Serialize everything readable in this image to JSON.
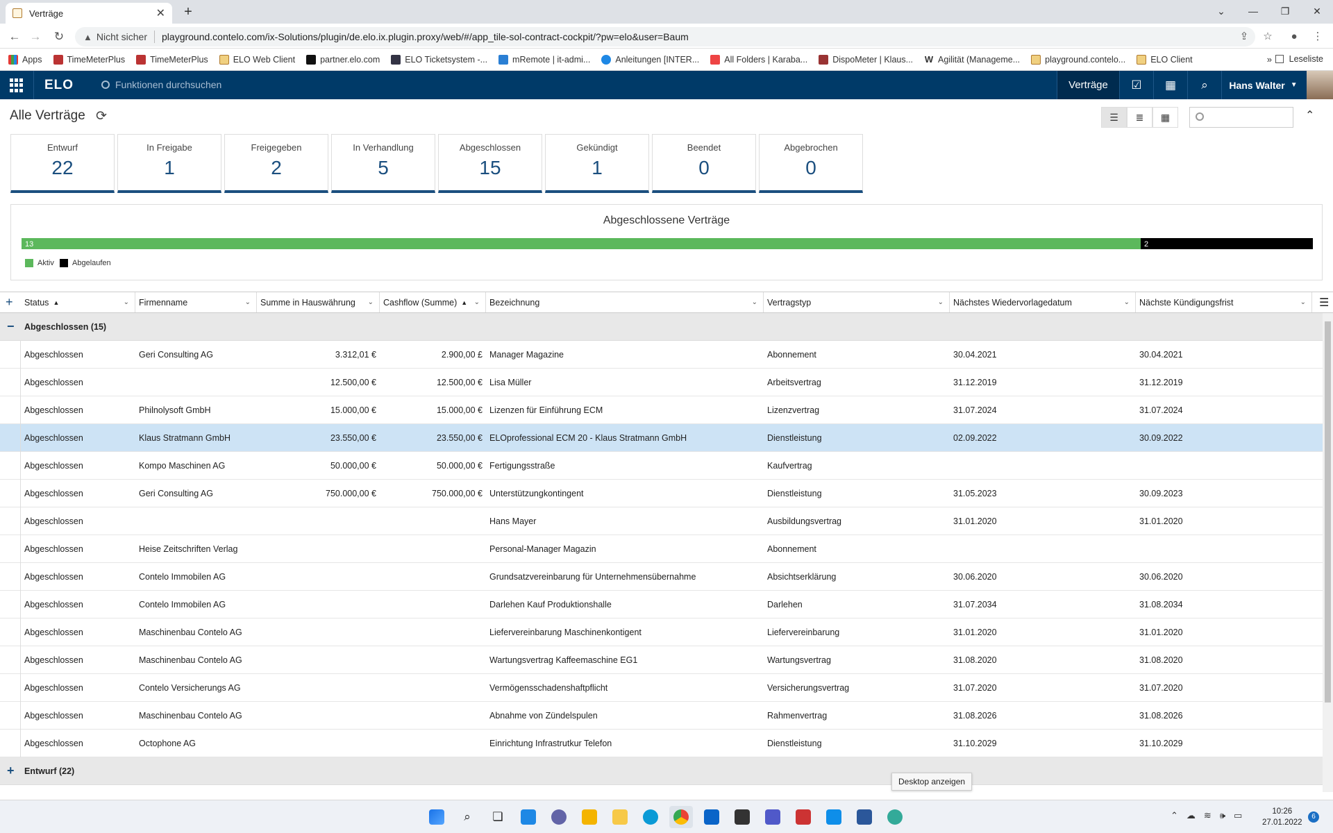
{
  "browser": {
    "tab_title": "Verträge",
    "security_label": "Nicht sicher",
    "url": "playground.contelo.com/ix-Solutions/plugin/de.elo.ix.plugin.proxy/web/#/app_tile-sol-contract-cockpit/?pw=elo&user=Baum",
    "bookmarks": [
      "Apps",
      "TimeMeterPlus",
      "TimeMeterPlus",
      "ELO Web Client",
      "partner.elo.com",
      "ELO Ticketsystem -...",
      "mRemote | it-admi...",
      "Anleitungen [INTER...",
      "All Folders | Karaba...",
      "DispoMeter | Klaus...",
      "Agilität (Manageme...",
      "playground.contelo...",
      "ELO Client"
    ],
    "bookmarks_more": "»",
    "reading_list": "Leseliste"
  },
  "app": {
    "logo": "ELO",
    "search_placeholder": "Funktionen durchsuchen",
    "nav_active": "Verträge",
    "user_name": "Hans Walter"
  },
  "page": {
    "title": "Alle Verträge"
  },
  "status_cards": [
    {
      "label": "Entwurf",
      "value": "22"
    },
    {
      "label": "In Freigabe",
      "value": "1"
    },
    {
      "label": "Freigegeben",
      "value": "2"
    },
    {
      "label": "In Verhandlung",
      "value": "5"
    },
    {
      "label": "Abgeschlossen",
      "value": "15"
    },
    {
      "label": "Gekündigt",
      "value": "1"
    },
    {
      "label": "Beendet",
      "value": "0"
    },
    {
      "label": "Abgebrochen",
      "value": "0"
    }
  ],
  "chart_data": {
    "type": "bar",
    "orientation": "horizontal-stacked",
    "title": "Abgeschlossene Verträge",
    "series": [
      {
        "name": "Aktiv",
        "values": [
          13
        ],
        "color": "#5cb85c"
      },
      {
        "name": "Abgelaufen",
        "values": [
          2
        ],
        "color": "#000000"
      }
    ],
    "data_labels": [
      "13",
      "2"
    ],
    "legend_position": "bottom-left"
  },
  "table": {
    "columns": [
      "Status",
      "Firmenname",
      "Summe in Hauswährung",
      "Cashflow (Summe)",
      "Bezeichnung",
      "Vertragstyp",
      "Nächstes Wiedervorlagedatum",
      "Nächste Kündigungsfrist"
    ],
    "groups": [
      {
        "label": "Abgeschlossen (15)",
        "expanded": true,
        "rows": [
          [
            "Abgeschlossen",
            "Geri Consulting AG",
            "3.312,01 €",
            "2.900,00 £",
            "Manager Magazine",
            "Abonnement",
            "30.04.2021",
            "30.04.2021"
          ],
          [
            "Abgeschlossen",
            "",
            "12.500,00 €",
            "12.500,00 €",
            "Lisa Müller",
            "Arbeitsvertrag",
            "31.12.2019",
            "31.12.2019"
          ],
          [
            "Abgeschlossen",
            "Philnolysoft GmbH",
            "15.000,00 €",
            "15.000,00 €",
            "Lizenzen für Einführung ECM",
            "Lizenzvertrag",
            "31.07.2024",
            "31.07.2024"
          ],
          [
            "Abgeschlossen",
            "Klaus Stratmann GmbH",
            "23.550,00 €",
            "23.550,00 €",
            "ELOprofessional ECM 20 - Klaus Stratmann GmbH",
            "Dienstleistung",
            "02.09.2022",
            "30.09.2022"
          ],
          [
            "Abgeschlossen",
            "Kompo Maschinen AG",
            "50.000,00 €",
            "50.000,00 €",
            "Fertigungsstraße",
            "Kaufvertrag",
            "",
            ""
          ],
          [
            "Abgeschlossen",
            "Geri Consulting AG",
            "750.000,00 €",
            "750.000,00 €",
            "Unterstützungkontingent",
            "Dienstleistung",
            "31.05.2023",
            "30.09.2023"
          ],
          [
            "Abgeschlossen",
            "",
            "",
            "",
            "Hans Mayer",
            "Ausbildungsvertrag",
            "31.01.2020",
            "31.01.2020"
          ],
          [
            "Abgeschlossen",
            "Heise Zeitschriften Verlag",
            "",
            "",
            "Personal-Manager Magazin",
            "Abonnement",
            "",
            ""
          ],
          [
            "Abgeschlossen",
            "Contelo Immobilen AG",
            "",
            "",
            "Grundsatzvereinbarung für Unternehmensübernahme",
            "Absichtserklärung",
            "30.06.2020",
            "30.06.2020"
          ],
          [
            "Abgeschlossen",
            "Contelo Immobilen AG",
            "",
            "",
            "Darlehen Kauf Produktionshalle",
            "Darlehen",
            "31.07.2034",
            "31.08.2034"
          ],
          [
            "Abgeschlossen",
            "Maschinenbau Contelo AG",
            "",
            "",
            "Liefervereinbarung Maschinenkontigent",
            "Liefervereinbarung",
            "31.01.2020",
            "31.01.2020"
          ],
          [
            "Abgeschlossen",
            "Maschinenbau Contelo AG",
            "",
            "",
            "Wartungsvertrag Kaffeemaschine EG1",
            "Wartungsvertrag",
            "31.08.2020",
            "31.08.2020"
          ],
          [
            "Abgeschlossen",
            "Contelo Versicherungs AG",
            "",
            "",
            "Vermögensschadenshaftpflicht",
            "Versicherungsvertrag",
            "31.07.2020",
            "31.07.2020"
          ],
          [
            "Abgeschlossen",
            "Maschinenbau Contelo AG",
            "",
            "",
            "Abnahme von Zündelspulen",
            "Rahmenvertrag",
            "31.08.2026",
            "31.08.2026"
          ],
          [
            "Abgeschlossen",
            "Octophone AG",
            "",
            "",
            "Einrichtung Infrastrutkur Telefon",
            "Dienstleistung",
            "31.10.2029",
            "31.10.2029"
          ]
        ]
      },
      {
        "label": "Entwurf (22)",
        "expanded": false,
        "rows": []
      }
    ],
    "selected_row_index": 3
  },
  "tooltip": "Desktop anzeigen",
  "taskbar": {
    "time": "10:26",
    "date": "27.01.2022",
    "notification_count": "6"
  }
}
